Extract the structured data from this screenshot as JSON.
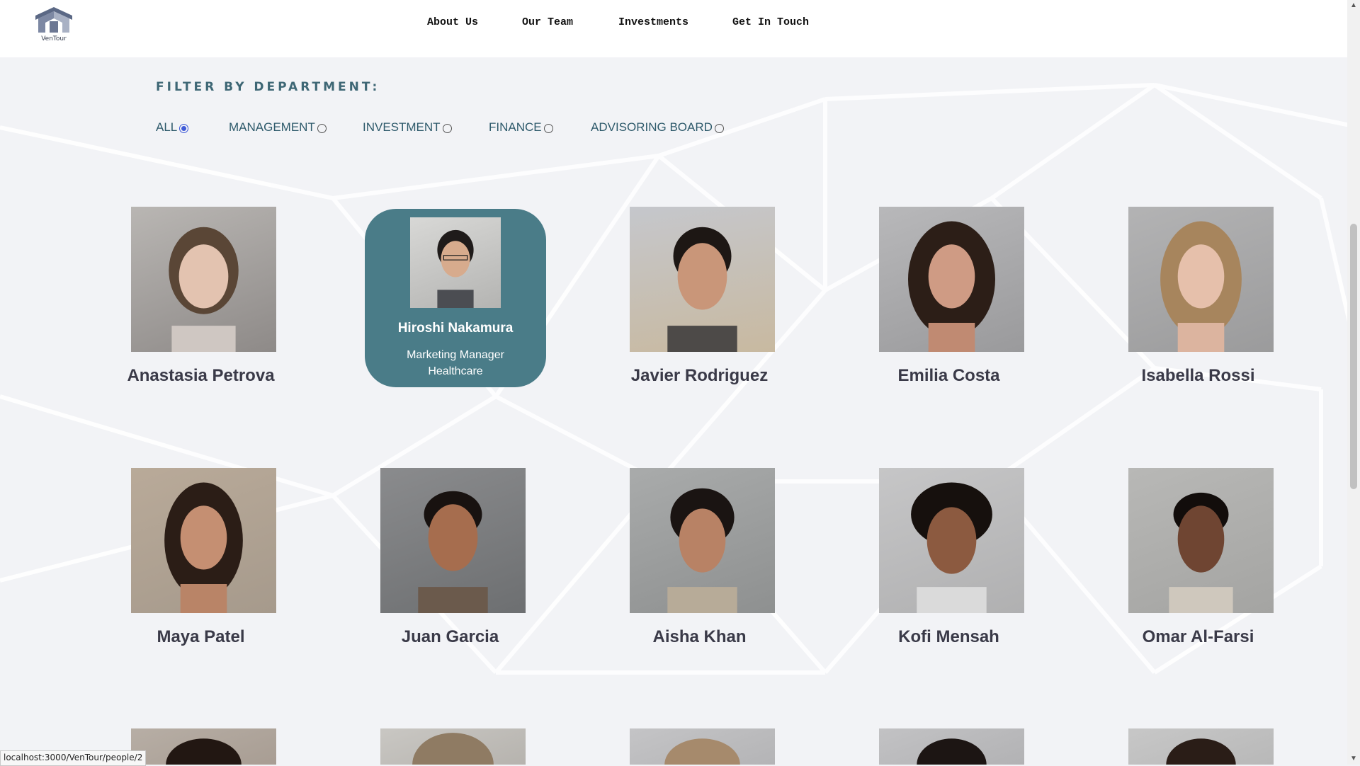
{
  "brand": {
    "name": "VenTour"
  },
  "nav": [
    "About Us",
    "Our Team",
    "Investments",
    "Get In Touch"
  ],
  "filter": {
    "title": "FILTER BY DEPARTMENT:",
    "options": [
      "ALL",
      "MANAGEMENT",
      "INVESTMENT",
      "FINANCE",
      "ADVISORING BOARD"
    ],
    "selected": "ALL"
  },
  "people": [
    "Anastasia Petrova",
    "Hiroshi Nakamura",
    "Javier Rodriguez",
    "Emilia Costa",
    "Isabella Rossi",
    "Maya Patel",
    "Juan Garcia",
    "Aisha Khan",
    "Kofi Mensah",
    "Omar Al-Farsi"
  ],
  "hovered": {
    "name": "Hiroshi Nakamura",
    "role": "Marketing Manager",
    "sector": "Healthcare"
  },
  "status_url": "localhost:3000/VenTour/people/2",
  "colors": {
    "accent": "#4a7c88",
    "filter_text": "#2e5a6b",
    "radio_selected": "#3f5bd8"
  }
}
